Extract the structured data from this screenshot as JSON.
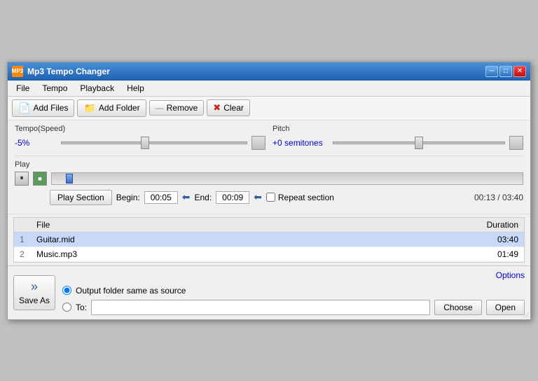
{
  "titlebar": {
    "title": "Mp3 Tempo Changer",
    "icon_label": "MP3",
    "min_btn": "─",
    "max_btn": "□",
    "close_btn": "✕"
  },
  "menubar": {
    "items": [
      "File",
      "Tempo",
      "Playback",
      "Help"
    ]
  },
  "toolbar": {
    "add_files": "Add Files",
    "add_folder": "Add Folder",
    "remove": "Remove",
    "clear": "Clear"
  },
  "tempo": {
    "label": "Tempo(Speed)",
    "value": "-5%"
  },
  "pitch": {
    "label": "Pitch",
    "value": "+0 semitones"
  },
  "play": {
    "label": "Play",
    "section_btn": "Play Section",
    "begin_label": "Begin:",
    "begin_value": "00:05",
    "end_label": "End:",
    "end_value": "00:09",
    "repeat_label": "Repeat section",
    "time_display": "00:13 / 03:40"
  },
  "file_table": {
    "headers": [
      "File",
      "Duration"
    ],
    "rows": [
      {
        "num": "1",
        "file": "Guitar.mid",
        "duration": "03:40"
      },
      {
        "num": "2",
        "file": "Music.mp3",
        "duration": "01:49"
      }
    ]
  },
  "bottom": {
    "save_as_label": "Save As",
    "save_as_icon": "»",
    "output_same": "Output folder same as source",
    "output_to": "To:",
    "to_placeholder": "",
    "choose_btn": "Choose",
    "open_btn": "Open",
    "options_link": "Options"
  }
}
